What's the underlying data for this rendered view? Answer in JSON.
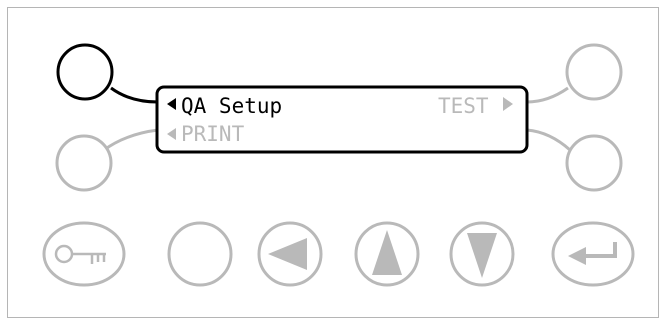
{
  "display": {
    "line1_left": "QA Setup",
    "line1_right": "TEST",
    "line2_left": "PRINT"
  },
  "soft_keys": {
    "top_left": {
      "active": true
    },
    "top_right": {
      "active": false
    },
    "bottom_left": {
      "active": false
    },
    "bottom_right": {
      "active": false
    }
  },
  "keypad": {
    "buttons": [
      "key-icon",
      "blank",
      "left-arrow-icon",
      "up-arrow-icon",
      "down-arrow-icon",
      "enter-icon"
    ]
  },
  "colors": {
    "active": "#000000",
    "inactive": "#b9b9b9",
    "frame": "#b5b5b5"
  }
}
